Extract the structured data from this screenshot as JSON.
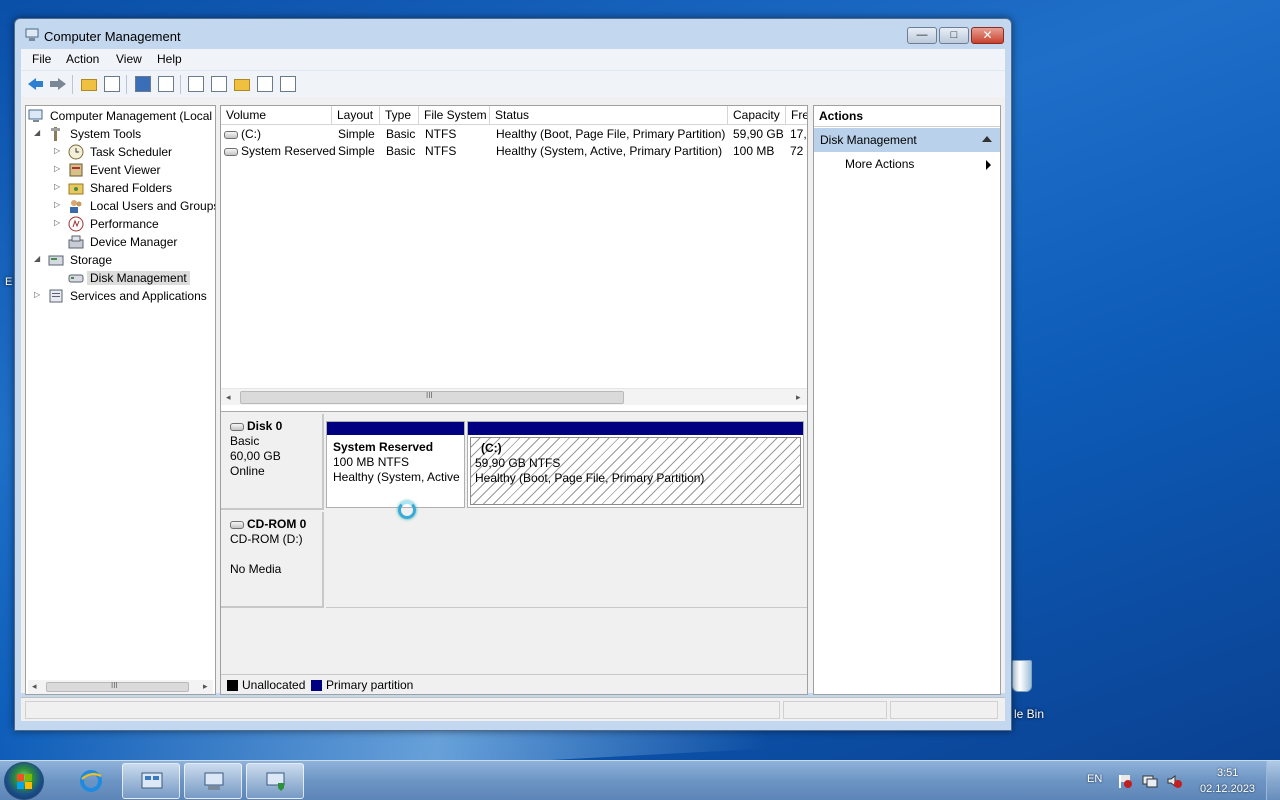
{
  "window": {
    "title": "Computer Management",
    "min_glyph": "—",
    "max_glyph": "□",
    "close_glyph": "✕"
  },
  "menu": [
    "File",
    "Action",
    "View",
    "Help"
  ],
  "tree": {
    "items": [
      {
        "label": "Computer Management (Local",
        "icon": "computer-icon"
      },
      {
        "label": "System Tools",
        "icon": "tools-icon"
      },
      {
        "label": "Task Scheduler",
        "icon": "clock-icon"
      },
      {
        "label": "Event Viewer",
        "icon": "event-viewer-icon"
      },
      {
        "label": "Shared Folders",
        "icon": "shared-folder-icon"
      },
      {
        "label": "Local Users and Groups",
        "icon": "users-icon"
      },
      {
        "label": "Performance",
        "icon": "performance-icon"
      },
      {
        "label": "Device Manager",
        "icon": "device-manager-icon"
      },
      {
        "label": "Storage",
        "icon": "storage-icon"
      },
      {
        "label": "Disk Management",
        "icon": "disk-management-icon"
      },
      {
        "label": "Services and Applications",
        "icon": "services-icon"
      }
    ],
    "scroll_glyph": "III",
    "scroll_left": "◂",
    "scroll_right": "▸"
  },
  "volume_list": {
    "columns": [
      "Volume",
      "Layout",
      "Type",
      "File System",
      "Status",
      "Capacity",
      "Fre"
    ],
    "rows": [
      {
        "volume": "(C:)",
        "layout": "Simple",
        "type": "Basic",
        "fs": "NTFS",
        "status": "Healthy (Boot, Page File, Primary Partition)",
        "capacity": "59,90 GB",
        "free": "17,"
      },
      {
        "volume": "System Reserved",
        "layout": "Simple",
        "type": "Basic",
        "fs": "NTFS",
        "status": "Healthy (System, Active, Primary Partition)",
        "capacity": "100 MB",
        "free": "72"
      }
    ],
    "scroll_glyph": "III",
    "scroll_left": "◂",
    "scroll_right": "▸"
  },
  "disks": [
    {
      "name": "Disk 0",
      "type": "Basic",
      "size": "60,00 GB",
      "state": "Online"
    },
    {
      "name": "CD-ROM 0",
      "type": "CD-ROM (D:)",
      "size": "",
      "state": "No Media"
    }
  ],
  "partitions": [
    {
      "name": "System Reserved",
      "size_fs": "100 MB NTFS",
      "status": "Healthy (System, Active"
    },
    {
      "name": "(C:)",
      "size_fs": "59,90 GB NTFS",
      "status": "Healthy (Boot, Page File, Primary Partition)"
    }
  ],
  "legend": [
    {
      "label": "Unallocated",
      "color": "#000000"
    },
    {
      "label": "Primary partition",
      "color": "#000080"
    }
  ],
  "actions": {
    "header": "Actions",
    "section": "Disk Management",
    "item": "More Actions"
  },
  "desktop": {
    "recycle_label": "le Bin",
    "edge_label": "E"
  },
  "taskbar": {
    "lang": "EN",
    "time": "3:51",
    "date": "02.12.2023"
  },
  "colors": {
    "partition_band": "#000080",
    "selection": "#b9d1ea"
  }
}
